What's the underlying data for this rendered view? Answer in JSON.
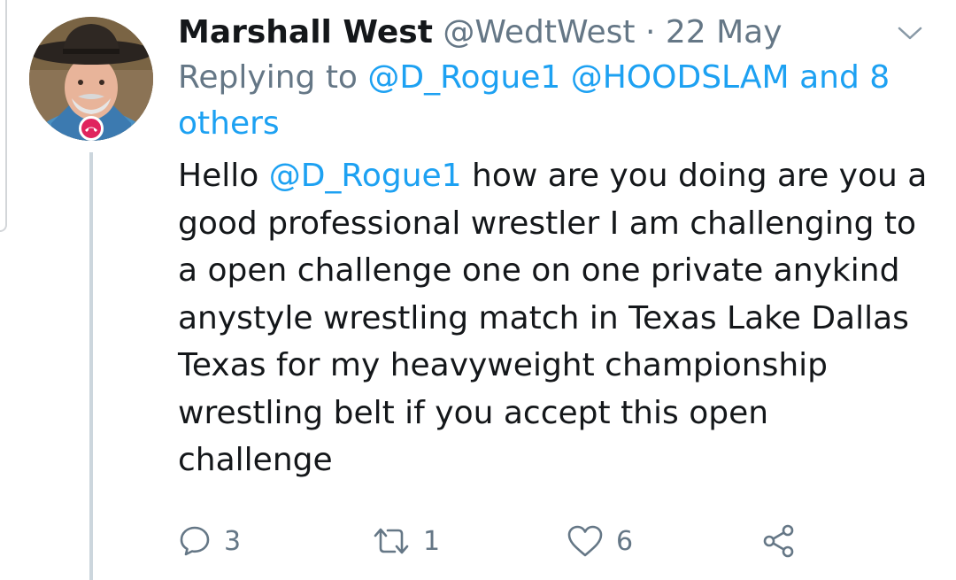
{
  "tweet": {
    "display_name": "Marshall West",
    "handle": "@WedtWest",
    "separator": "·",
    "timestamp": "22 May",
    "replying_prefix": "Replying to ",
    "replying_mention_1": "@D_Rogue1",
    "replying_mention_2": "@HOODSLAM",
    "replying_others": "and 8 others",
    "body_part_1": "Hello ",
    "body_mention": "@D_Rogue1",
    "body_part_2": " how are you doing are you a good professional wrestler I am challenging to a open challenge one on one private anykind anystyle wrestling match in Texas Lake Dallas Texas for my heavyweight championship wrestling belt if you accept this open challenge"
  },
  "actions": {
    "reply_count": "3",
    "retweet_count": "1",
    "like_count": "6"
  },
  "icons": {
    "reply": "reply-icon",
    "retweet": "retweet-icon",
    "like": "like-icon",
    "share": "share-icon",
    "menu": "chevron-down-icon",
    "call": "end-call-icon"
  },
  "colors": {
    "link": "#1da1f2",
    "secondary_text": "#657786",
    "primary_text": "#14171a",
    "thread_line": "#ccd6dd",
    "call_badge": "#e0245e"
  }
}
